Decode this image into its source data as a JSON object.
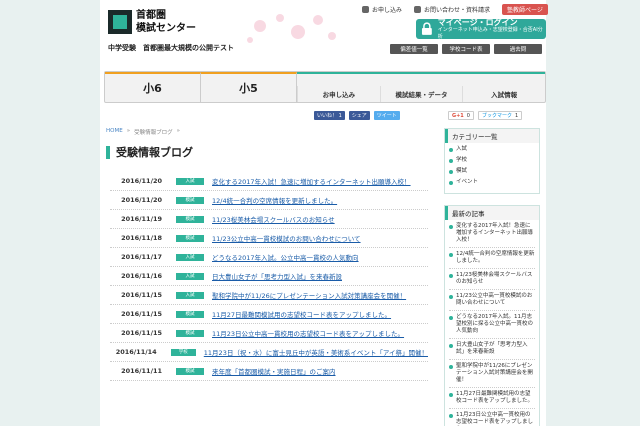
{
  "header": {
    "logo_line1": "首都圏",
    "logo_line2": "模試センター",
    "tagline": "中学受験　首都圏最大規模の公開テスト",
    "top_links": [
      "お申し込み",
      "お問い合わせ・資料請求"
    ],
    "teacher_button": "塾教師ページ",
    "mypage_title": "マイページ・ログイン",
    "mypage_sub": "インターネット申込み・志望校登録・合否AI分析",
    "small_tabs": [
      "偏差値一覧",
      "学校コード表",
      "過去問"
    ]
  },
  "nav": {
    "grades": [
      "小6",
      "小5"
    ],
    "items": [
      "お申し込み",
      "模試結果・データ",
      "入試情報"
    ]
  },
  "social": {
    "fb_like": "いいね！ 1",
    "fb_share": "シェア",
    "tweet": "ツイート",
    "gplus": "G+1",
    "gplus_count": "0",
    "bookmark": "ブックマーク",
    "bookmark_count": "1"
  },
  "breadcrumb": {
    "home": "HOME",
    "sep": "»",
    "current": "受験情報ブログ",
    "sep2": "»"
  },
  "page_title": "受験情報ブログ",
  "articles": [
    {
      "date": "2016/11/20",
      "cat": "入試",
      "title": "変化する2017年入試！急速に増加するインターネット出願導入校！"
    },
    {
      "date": "2016/11/20",
      "cat": "模試",
      "title": "12/4統一合判の空席情報を更新しました。"
    },
    {
      "date": "2016/11/19",
      "cat": "模試",
      "title": "11/23桜美林会場スクールバスのお知らせ"
    },
    {
      "date": "2016/11/18",
      "cat": "模試",
      "title": "11/23公立中高一貫校模試のお問い合わせについて"
    },
    {
      "date": "2016/11/17",
      "cat": "入試",
      "title": "どうなる2017年入試。公立中高一貫校の人気動向"
    },
    {
      "date": "2016/11/16",
      "cat": "入試",
      "title": "日大豊山女子が「思考力型入試」を来春新設"
    },
    {
      "date": "2016/11/15",
      "cat": "入試",
      "title": "聖和学院中が11/26にプレゼンテーション入試対策講座会を開催！"
    },
    {
      "date": "2016/11/15",
      "cat": "模試",
      "title": "11月27日最難関模試用の志望校コード表をアップしました。"
    },
    {
      "date": "2016/11/15",
      "cat": "模試",
      "title": "11月23日公立中高一貫校用の志望校コード表をアップしました。"
    },
    {
      "date": "2016/11/14",
      "cat": "学校",
      "title": "11月23日（祝・水）に富士見丘中が英語・美術系イベント「アイ祭」開催！"
    },
    {
      "date": "2016/11/11",
      "cat": "模試",
      "title": "来年度「首都圏模試・実施日程」のご案内"
    }
  ],
  "sidebar": {
    "category_title": "カテゴリー一覧",
    "categories": [
      "入試",
      "学校",
      "模試",
      "イベント"
    ],
    "recent_title": "最新の記事",
    "recent": [
      "変化する2017年入試！急速に増加するインターネット出願導入校！",
      "12/4統一合判の空席情報を更新しました。",
      "11/23桜美林会場スクールバスのお知らせ",
      "11/23公立中高一貫校模試のお問い合わせについて",
      "どうなる2017年入試。11月志望校別に探る公立中高一貫校の人気動向",
      "日大豊山女子が「思考力型入試」を来春新設",
      "聖和学院中が11/26にプレゼンテーション入試対策講座会を開催！",
      "11月27日最難関模試用の志望校コード表をアップしました。",
      "11月23日公立中高一貫校用の志望校コード表をアップしました。"
    ]
  },
  "colors": {
    "accent": "#2fb39a",
    "link": "#1a5ca8",
    "orange": "#f0a020"
  }
}
